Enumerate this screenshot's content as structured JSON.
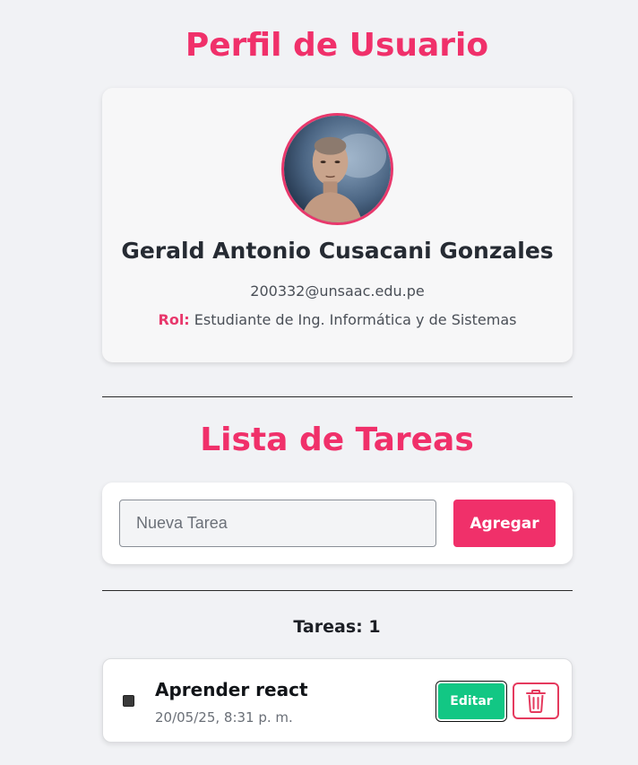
{
  "profile": {
    "heading": "Perfil de Usuario",
    "name": "Gerald Antonio Cusacani Gonzales",
    "email": "200332@unsaac.edu.pe",
    "role_label": "Rol:",
    "role_value": "Estudiante de Ing. Informática y de Sistemas"
  },
  "tasks": {
    "heading": "Lista de Tareas",
    "input_placeholder": "Nueva Tarea",
    "input_value": "",
    "add_button": "Agregar",
    "count_text": "Tareas: 1",
    "items": [
      {
        "title": "Aprender react",
        "date": "20/05/25, 8:31 p. m.",
        "edit_label": "Editar",
        "delete_icon": "trash-icon"
      }
    ]
  },
  "colors": {
    "accent": "#f0306a",
    "edit_green": "#12c784",
    "delete_red": "#e53a5e",
    "background": "#f1f2f5"
  }
}
